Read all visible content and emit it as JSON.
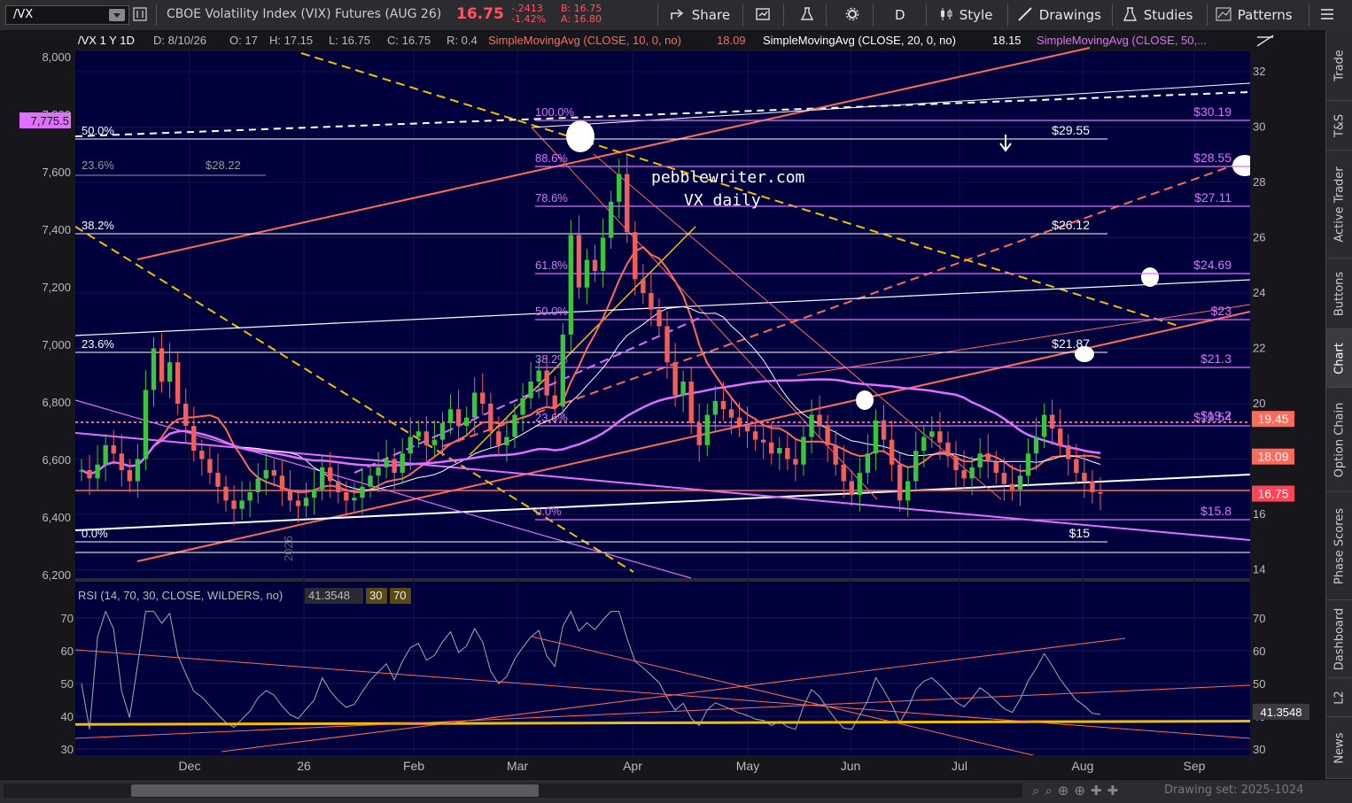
{
  "toolbar": {
    "symbol": "/VX",
    "title": "CBOE Volatility Index (VIX) Futures (AUG 26)",
    "last": "16.75",
    "change": "-.2413",
    "change_pct": "-1.42%",
    "bid": "B: 16.75",
    "ask": "A: 16.80",
    "share": "Share",
    "period": "D",
    "style": "Style",
    "drawings": "Drawings",
    "studies": "Studies",
    "patterns": "Patterns"
  },
  "legend": {
    "header": "/VX 1 Y 1D",
    "date": "D: 8/10/26",
    "open": "O: 17",
    "high": "H: 17.15",
    "low": "L: 16.75",
    "close": "C: 16.75",
    "range": "R: 0.4",
    "sma10_label": "SimpleMovingAvg (CLOSE, 10, 0, no)",
    "sma10_value": "18.09",
    "sma20_label": "SimpleMovingAvg (CLOSE, 20, 0, no)",
    "sma20_value": "18.15",
    "sma50_label": "SimpleMovingAvg (CLOSE, 50,..."
  },
  "rsi_legend": {
    "label": "RSI (14, 70, 30, CLOSE, WILDERS, no)",
    "value": "41.3548",
    "ob": "30",
    "os": "70"
  },
  "watermark": {
    "line1": "pebblewriter.com",
    "line2": "VX daily"
  },
  "colors": {
    "background": "#00003a",
    "price_down": "#f0605a",
    "price_up": "#3cc43c",
    "fib": "#e070ff",
    "trend_red": "#ff6a5a",
    "yellow": "#f0c000",
    "white": "#ffffff"
  },
  "chart_data": {
    "type": "line",
    "x_ticks": [
      "Dec",
      "26",
      "Feb",
      "Mar",
      "Apr",
      "May",
      "Jun",
      "Jul",
      "Aug",
      "Sep"
    ],
    "right_ticks": [
      "32",
      "30",
      "28",
      "26",
      "24",
      "22",
      "20",
      "18",
      "16",
      "14"
    ],
    "left_ticks": [
      "8,000",
      "7,800",
      "7,600",
      "7,400",
      "7,200",
      "7,000",
      "6,800",
      "6,600",
      "6,400",
      "6,200"
    ],
    "left_marker": "7,775.5",
    "rsi_ticks": [
      "70",
      "60",
      "50",
      "40",
      "30"
    ],
    "price_markers": {
      "sma20": "19.45",
      "sma10": "18.09",
      "last": "16.75",
      "rsi": "41.3548"
    },
    "fib_levels": [
      {
        "pct": "100.0%",
        "label": "$30.19"
      },
      {
        "pct": "88.6%",
        "label": "$28.55"
      },
      {
        "pct": "78.6%",
        "label": "$27.11"
      },
      {
        "pct": "61.8%",
        "label": "$24.69"
      },
      {
        "pct": "50.0%",
        "label": "$23"
      },
      {
        "pct": "38.2%",
        "label": "$21.3"
      },
      {
        "pct": "23.6%",
        "label": "$19.54"
      },
      {
        "pct": "0.0%",
        "label": "$15.8"
      }
    ],
    "white_levels": [
      "$29.55",
      "$26.12",
      "$21.87",
      "$15"
    ],
    "white_fib": [
      "50.0%",
      "38.2%",
      "23.6%",
      "0.0%"
    ],
    "gray_fib": {
      "pct": "23.6%",
      "label": "$28.22"
    },
    "other_label": "$19.2",
    "year_mark": "2026",
    "close_series": [
      17.6,
      17.3,
      17.8,
      18.5,
      18.2,
      17.6,
      17.2,
      18.0,
      20.5,
      22.0,
      20.8,
      21.5,
      20.0,
      19.2,
      18.3,
      18.0,
      17.5,
      17.0,
      16.5,
      16.2,
      16.5,
      16.8,
      17.3,
      17.6,
      17.4,
      16.9,
      16.5,
      16.3,
      16.6,
      16.9,
      17.7,
      17.2,
      16.8,
      16.5,
      16.6,
      17.0,
      17.4,
      17.7,
      18.0,
      17.5,
      18.2,
      18.8,
      19.0,
      18.5,
      18.7,
      19.3,
      19.8,
      19.2,
      19.5,
      20.4,
      20.0,
      19.0,
      18.5,
      18.8,
      19.6,
      20.2,
      20.8,
      21.2,
      20.3,
      19.9,
      22.5,
      26.1,
      24.2,
      25.2,
      24.8,
      26.0,
      27.3,
      28.3,
      26.2,
      24.5,
      24.0,
      23.4,
      22.8,
      21.5,
      20.3,
      20.8,
      19.3,
      18.5,
      19.6,
      20.1,
      19.8,
      19.5,
      19.2,
      19.0,
      18.7,
      18.6,
      18.2,
      18.4,
      18.0,
      17.8,
      18.8,
      19.6,
      19.2,
      18.5,
      17.8,
      17.2,
      16.7,
      17.5,
      18.2,
      19.4,
      18.7,
      17.8,
      16.5,
      17.2,
      18.3,
      18.8,
      19.0,
      18.6,
      18.1,
      17.6,
      17.3,
      17.7,
      18.2,
      17.9,
      17.5,
      17.1,
      16.9,
      17.4,
      18.2,
      18.8,
      19.6,
      19.1,
      18.5,
      18.0,
      17.5,
      17.2,
      16.8,
      16.75
    ]
  }
}
